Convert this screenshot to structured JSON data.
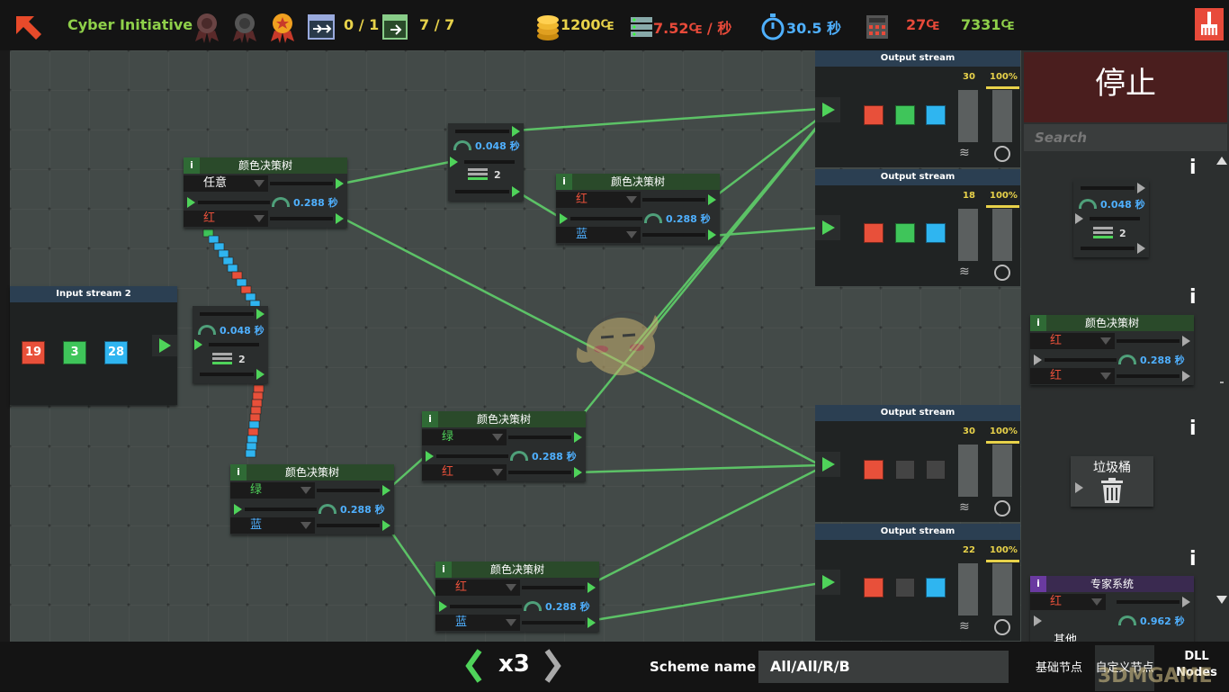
{
  "header": {
    "title": "Cyber Initiative",
    "counter1": "0 / 1",
    "counter2": "7 / 7",
    "money": "1200₠",
    "rate": "7.52₠ / 秒",
    "timer": "30.5 秒",
    "cost": "27₠",
    "total": "7331₠"
  },
  "input_stream": {
    "title": "Input stream 2",
    "red": "19",
    "green": "3",
    "blue": "28"
  },
  "nodes": {
    "splitter_time": "0.048 秒",
    "splitter_count": "2",
    "tree_title": "颜色决策树",
    "tree_time": "0.288 秒",
    "any": "任意",
    "red": "红",
    "green": "绿",
    "blue": "蓝"
  },
  "outputs": [
    {
      "title": "Output stream",
      "count": "30",
      "pct": "100%"
    },
    {
      "title": "Output stream",
      "count": "18",
      "pct": "100%"
    },
    {
      "title": "Output stream",
      "count": "30",
      "pct": "100%"
    },
    {
      "title": "Output stream",
      "count": "22",
      "pct": "100%"
    }
  ],
  "panel": {
    "stop": "停止",
    "search_placeholder": "Search",
    "splitter_time": "0.048 秒",
    "splitter_count": "2",
    "tree_title": "颜色决策树",
    "tree_red1": "红",
    "tree_red2": "红",
    "tree_time": "0.288 秒",
    "trash": "垃圾桶",
    "expert_title": "专家系统",
    "expert_red": "红",
    "expert_other": "其他",
    "expert_time": "0.962 秒",
    "info": "i"
  },
  "footer": {
    "speed": "x3",
    "scheme_label": "Scheme name :",
    "scheme_value": "All/All/R/B",
    "tab_basic": "基础节点",
    "tab_custom": "自定义节点",
    "tab_dll": "DLL Nodes",
    "watermark": "3DMGAME"
  },
  "colors": {
    "accent": "#e8d24a",
    "wire": "#5fcf6a",
    "red": "#e8503a",
    "green": "#3fc55a",
    "blue": "#2fb5f0"
  }
}
